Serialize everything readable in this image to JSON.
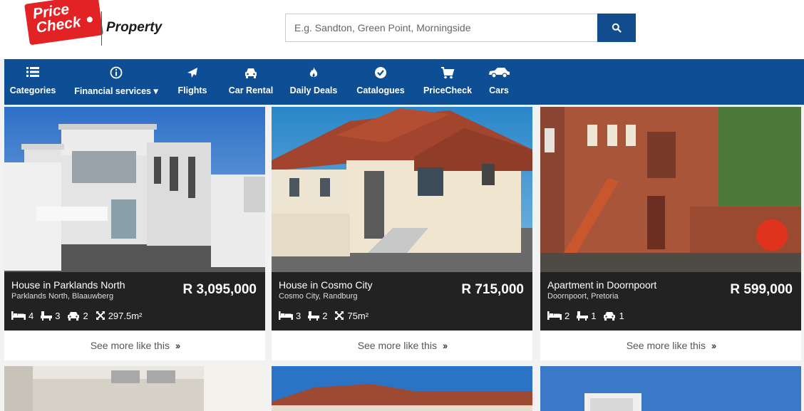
{
  "header": {
    "logo": {
      "line1": "Price",
      "line2": "Check",
      "product": "Property"
    },
    "search": {
      "placeholder": "E.g. Sandton, Green Point, Morningside"
    }
  },
  "nav": {
    "items": [
      {
        "label": "Categories",
        "icon": "list-icon"
      },
      {
        "label": "Financial services ▾",
        "icon": "info-icon"
      },
      {
        "label": "Flights",
        "icon": "plane-icon"
      },
      {
        "label": "Car Rental",
        "icon": "car-icon"
      },
      {
        "label": "Daily Deals",
        "icon": "fire-icon"
      },
      {
        "label": "Catalogues",
        "icon": "check-circle-icon"
      },
      {
        "label": "PriceCheck",
        "icon": "cart-icon"
      },
      {
        "label": "Cars",
        "icon": "car-side-icon"
      }
    ]
  },
  "listings": [
    {
      "title": "House in Parklands North",
      "location": "Parklands North, Blaauwberg",
      "price": "R 3,095,000",
      "bedrooms": "4",
      "bathrooms": "3",
      "garages": "2",
      "size": "297.5m²",
      "more": "See more like this"
    },
    {
      "title": "House in Cosmo City",
      "location": "Cosmo City, Randburg",
      "price": "R 715,000",
      "bedrooms": "3",
      "bathrooms": "2",
      "size": "75m²",
      "more": "See more like this"
    },
    {
      "title": "Apartment in Doornpoort",
      "location": "Doornpoort, Pretoria",
      "price": "R 599,000",
      "bedrooms": "2",
      "bathrooms": "1",
      "garages": "1",
      "more": "See more like this"
    }
  ],
  "colors": {
    "brand_red": "#e32226",
    "nav_blue": "#0d4e95",
    "card_dark": "#222222"
  }
}
